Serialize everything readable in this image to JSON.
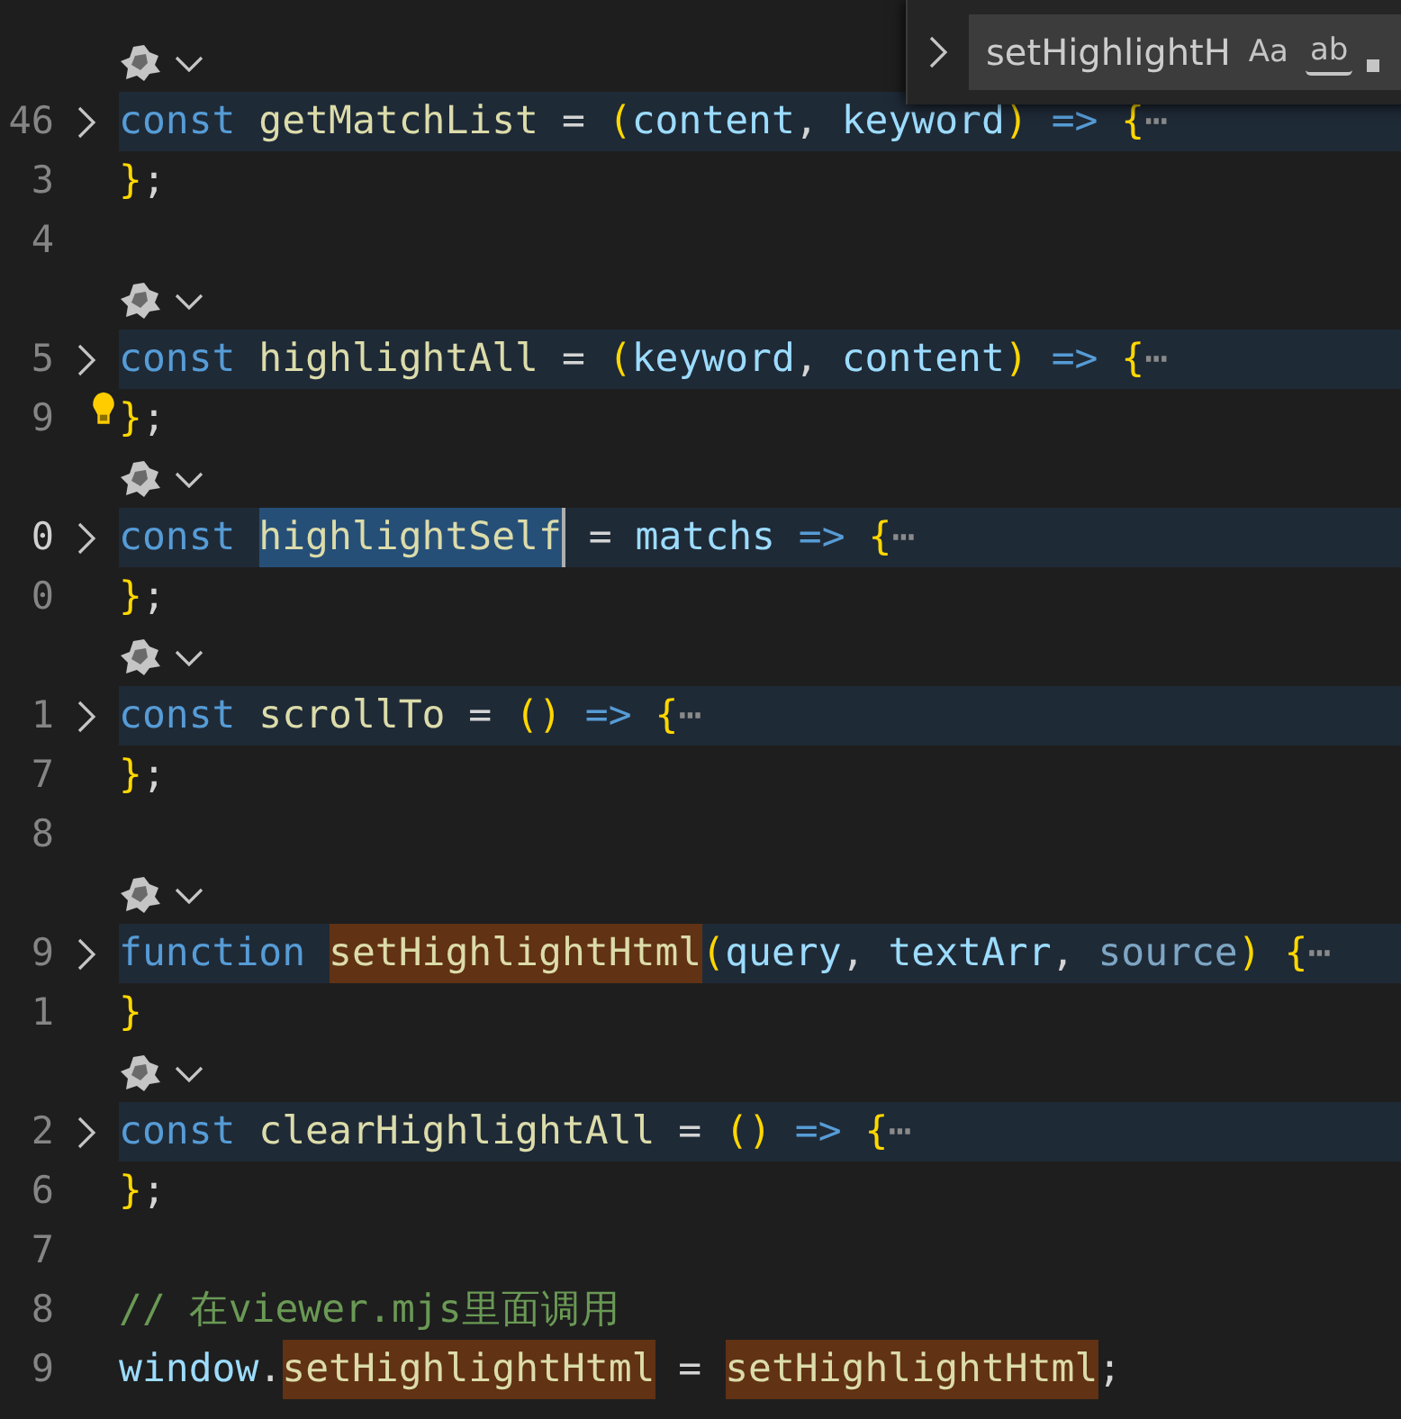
{
  "editor": {
    "lines": [
      {
        "kind": "codelens"
      },
      {
        "kind": "code",
        "number": "46",
        "folded": true,
        "current": false,
        "tokens": [
          {
            "text": "const ",
            "kind": "keyword"
          },
          {
            "text": "getMatchList",
            "kind": "function"
          },
          {
            "text": " = ",
            "kind": "operator"
          },
          {
            "text": "(",
            "kind": "bracket"
          },
          {
            "text": "content",
            "kind": "param"
          },
          {
            "text": ", ",
            "kind": "operator"
          },
          {
            "text": "keyword",
            "kind": "param"
          },
          {
            "text": ")",
            "kind": "bracket"
          },
          {
            "text": " => ",
            "kind": "arrow"
          },
          {
            "text": "{",
            "kind": "bracket"
          },
          {
            "text": "⋯",
            "kind": "ellipsis"
          }
        ]
      },
      {
        "kind": "code",
        "number": "3",
        "folded": false,
        "current": false,
        "tokens": [
          {
            "text": "}",
            "kind": "bracket"
          },
          {
            "text": ";",
            "kind": "operator"
          }
        ]
      },
      {
        "kind": "code",
        "number": "4",
        "folded": false,
        "current": false
      },
      {
        "kind": "codelens"
      },
      {
        "kind": "code",
        "number": "5",
        "folded": true,
        "current": false,
        "tokens": [
          {
            "text": "const ",
            "kind": "keyword"
          },
          {
            "text": "highlightAll",
            "kind": "function"
          },
          {
            "text": " = ",
            "kind": "operator"
          },
          {
            "text": "(",
            "kind": "bracket"
          },
          {
            "text": "keyword",
            "kind": "param"
          },
          {
            "text": ", ",
            "kind": "operator"
          },
          {
            "text": "content",
            "kind": "param"
          },
          {
            "text": ")",
            "kind": "bracket"
          },
          {
            "text": " => ",
            "kind": "arrow"
          },
          {
            "text": "{",
            "kind": "bracket"
          },
          {
            "text": "⋯",
            "kind": "ellipsis"
          }
        ]
      },
      {
        "kind": "code",
        "number": "9",
        "folded": false,
        "current": false,
        "lightbulb": true,
        "tokens": [
          {
            "text": "}",
            "kind": "bracket"
          },
          {
            "text": ";",
            "kind": "operator"
          }
        ]
      },
      {
        "kind": "codelens"
      },
      {
        "kind": "code",
        "number": "0",
        "folded": true,
        "current": true,
        "tokens": [
          {
            "text": "const ",
            "kind": "keyword"
          },
          {
            "text": "highlightSelf",
            "kind": "selection"
          },
          {
            "text": " = ",
            "kind": "operator"
          },
          {
            "text": "matchs",
            "kind": "param"
          },
          {
            "text": " => ",
            "kind": "arrow"
          },
          {
            "text": "{",
            "kind": "bracket"
          },
          {
            "text": "⋯",
            "kind": "ellipsis"
          }
        ]
      },
      {
        "kind": "code",
        "number": "0",
        "folded": false,
        "current": false,
        "tokens": [
          {
            "text": "}",
            "kind": "bracket"
          },
          {
            "text": ";",
            "kind": "operator"
          }
        ]
      },
      {
        "kind": "codelens"
      },
      {
        "kind": "code",
        "number": "1",
        "folded": true,
        "current": false,
        "tokens": [
          {
            "text": "const ",
            "kind": "keyword"
          },
          {
            "text": "scrollTo",
            "kind": "function"
          },
          {
            "text": " = ",
            "kind": "operator"
          },
          {
            "text": "()",
            "kind": "bracket"
          },
          {
            "text": " => ",
            "kind": "arrow"
          },
          {
            "text": "{",
            "kind": "bracket"
          },
          {
            "text": "⋯",
            "kind": "ellipsis"
          }
        ]
      },
      {
        "kind": "code",
        "number": "7",
        "folded": false,
        "current": false,
        "tokens": [
          {
            "text": "}",
            "kind": "bracket"
          },
          {
            "text": ";",
            "kind": "operator"
          }
        ]
      },
      {
        "kind": "code",
        "number": "8",
        "folded": false,
        "current": false
      },
      {
        "kind": "codelens"
      },
      {
        "kind": "code",
        "number": "9",
        "folded": true,
        "current": false,
        "tokens": [
          {
            "text": "function ",
            "kind": "keyword"
          },
          {
            "text": "setHighlightHtml",
            "kind": "match"
          },
          {
            "text": "(",
            "kind": "bracket"
          },
          {
            "text": "query",
            "kind": "param"
          },
          {
            "text": ", ",
            "kind": "operator"
          },
          {
            "text": "textArr",
            "kind": "param"
          },
          {
            "text": ", ",
            "kind": "operator"
          },
          {
            "text": "source",
            "kind": "unused"
          },
          {
            "text": ")",
            "kind": "bracket"
          },
          {
            "text": " {",
            "kind": "bracket"
          },
          {
            "text": "⋯",
            "kind": "ellipsis"
          }
        ]
      },
      {
        "kind": "code",
        "number": "1",
        "folded": false,
        "current": false,
        "tokens": [
          {
            "text": "}",
            "kind": "bracket"
          }
        ]
      },
      {
        "kind": "codelens"
      },
      {
        "kind": "code",
        "number": "2",
        "folded": true,
        "current": false,
        "tokens": [
          {
            "text": "const ",
            "kind": "keyword"
          },
          {
            "text": "clearHighlightAll",
            "kind": "function"
          },
          {
            "text": " = ",
            "kind": "operator"
          },
          {
            "text": "()",
            "kind": "bracket"
          },
          {
            "text": " => ",
            "kind": "arrow"
          },
          {
            "text": "{",
            "kind": "bracket"
          },
          {
            "text": "⋯",
            "kind": "ellipsis"
          }
        ]
      },
      {
        "kind": "code",
        "number": "6",
        "folded": false,
        "current": false,
        "tokens": [
          {
            "text": "}",
            "kind": "bracket"
          },
          {
            "text": ";",
            "kind": "operator"
          }
        ]
      },
      {
        "kind": "code",
        "number": "7",
        "folded": false,
        "current": false
      },
      {
        "kind": "code",
        "number": "8",
        "folded": false,
        "current": false,
        "tokens": [
          {
            "text": "// 在viewer.mjs里面调用",
            "kind": "comment"
          }
        ]
      },
      {
        "kind": "code",
        "number": "9",
        "folded": false,
        "current": false,
        "tokens": [
          {
            "text": "window",
            "kind": "param"
          },
          {
            "text": ".",
            "kind": "operator"
          },
          {
            "text": "setHighlightHtml",
            "kind": "match"
          },
          {
            "text": " = ",
            "kind": "operator"
          },
          {
            "text": "setHighlightHtml",
            "kind": "match"
          },
          {
            "text": ";",
            "kind": "operator"
          }
        ]
      }
    ]
  },
  "find_widget": {
    "expanded": false,
    "value": "setHighlightH",
    "match_case": {
      "label": "Aa",
      "on": false
    },
    "whole_word": {
      "label": "ab",
      "on": false
    }
  }
}
